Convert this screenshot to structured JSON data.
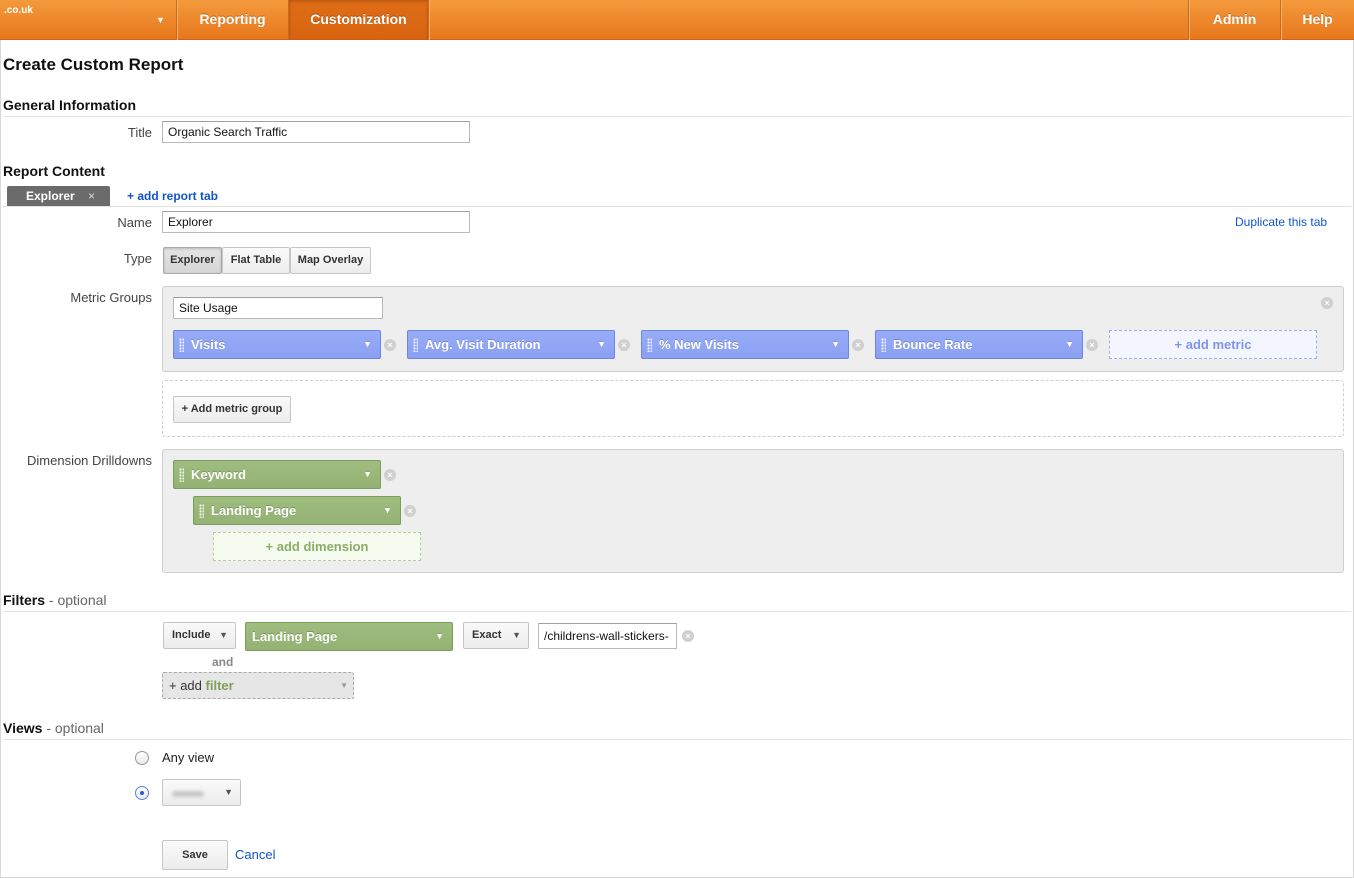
{
  "nav": {
    "account": ".co.uk",
    "items": [
      {
        "label": "Reporting"
      },
      {
        "label": "Customization"
      },
      {
        "label": "Admin"
      },
      {
        "label": "Help"
      }
    ],
    "accent_color": "#e8771d"
  },
  "page_title": "Create Custom Report",
  "general": {
    "heading": "General Information",
    "title_label": "Title",
    "title_value": "Organic Search Traffic"
  },
  "content": {
    "heading": "Report Content",
    "tab_label": "Explorer",
    "tab_close": "×",
    "add_tab": "+ add report tab",
    "name_label": "Name",
    "name_value": "Explorer",
    "duplicate": "Duplicate this tab",
    "type_label": "Type",
    "types": [
      "Explorer",
      "Flat Table",
      "Map Overlay"
    ],
    "metric_groups_label": "Metric Groups",
    "metric_group_name": "Site Usage",
    "metrics": [
      "Visits",
      "Avg. Visit Duration",
      "% New Visits",
      "Bounce Rate"
    ],
    "add_metric": "+ add metric",
    "add_metric_group": "+ Add metric group",
    "dimension_label": "Dimension Drilldowns",
    "dimensions": [
      "Keyword",
      "Landing Page"
    ],
    "add_dimension": "+ add dimension"
  },
  "filters": {
    "heading": "Filters",
    "optional": "- optional",
    "include": "Include",
    "dimension": "Landing Page",
    "match": "Exact",
    "value": "/childrens-wall-stickers-",
    "and": "and",
    "add_plus": "+ add",
    "add_word": "filter"
  },
  "views": {
    "heading": "Views",
    "optional": "- optional",
    "any_view": "Any view"
  },
  "actions": {
    "save": "Save",
    "cancel": "Cancel"
  }
}
